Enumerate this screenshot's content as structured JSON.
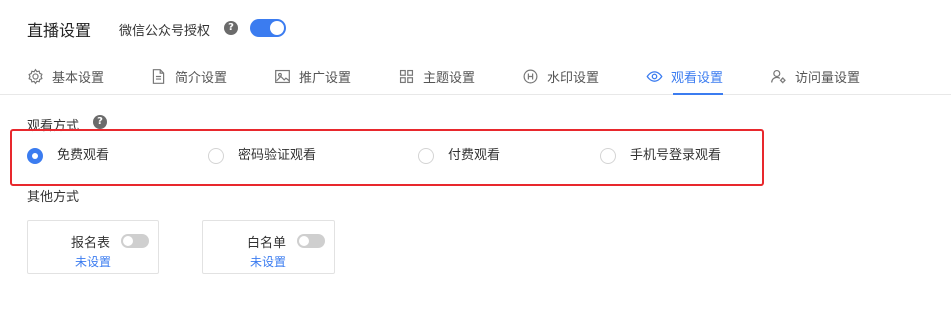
{
  "header": {
    "title": "直播设置",
    "auth_label": "微信公众号授权",
    "auth_enabled": true
  },
  "tabs": [
    {
      "label": "基本设置",
      "icon": "gear-icon",
      "active": false
    },
    {
      "label": "简介设置",
      "icon": "document-icon",
      "active": false
    },
    {
      "label": "推广设置",
      "icon": "image-icon",
      "active": false
    },
    {
      "label": "主题设置",
      "icon": "grid-icon",
      "active": false
    },
    {
      "label": "水印设置",
      "icon": "watermark-icon",
      "active": false
    },
    {
      "label": "观看设置",
      "icon": "eye-icon",
      "active": true
    },
    {
      "label": "访问量设置",
      "icon": "user-settings-icon",
      "active": false
    }
  ],
  "watch_mode": {
    "label": "观看方式",
    "selected": "免费观看",
    "options": [
      "免费观看",
      "密码验证观看",
      "付费观看",
      "手机号登录观看"
    ]
  },
  "other_modes": {
    "label": "其他方式",
    "cards": [
      {
        "title": "报名表",
        "enabled": false,
        "status": "未设置"
      },
      {
        "title": "白名单",
        "enabled": false,
        "status": "未设置"
      }
    ]
  },
  "colors": {
    "accent": "#3b7cf0",
    "highlight_border": "#e8282d"
  }
}
